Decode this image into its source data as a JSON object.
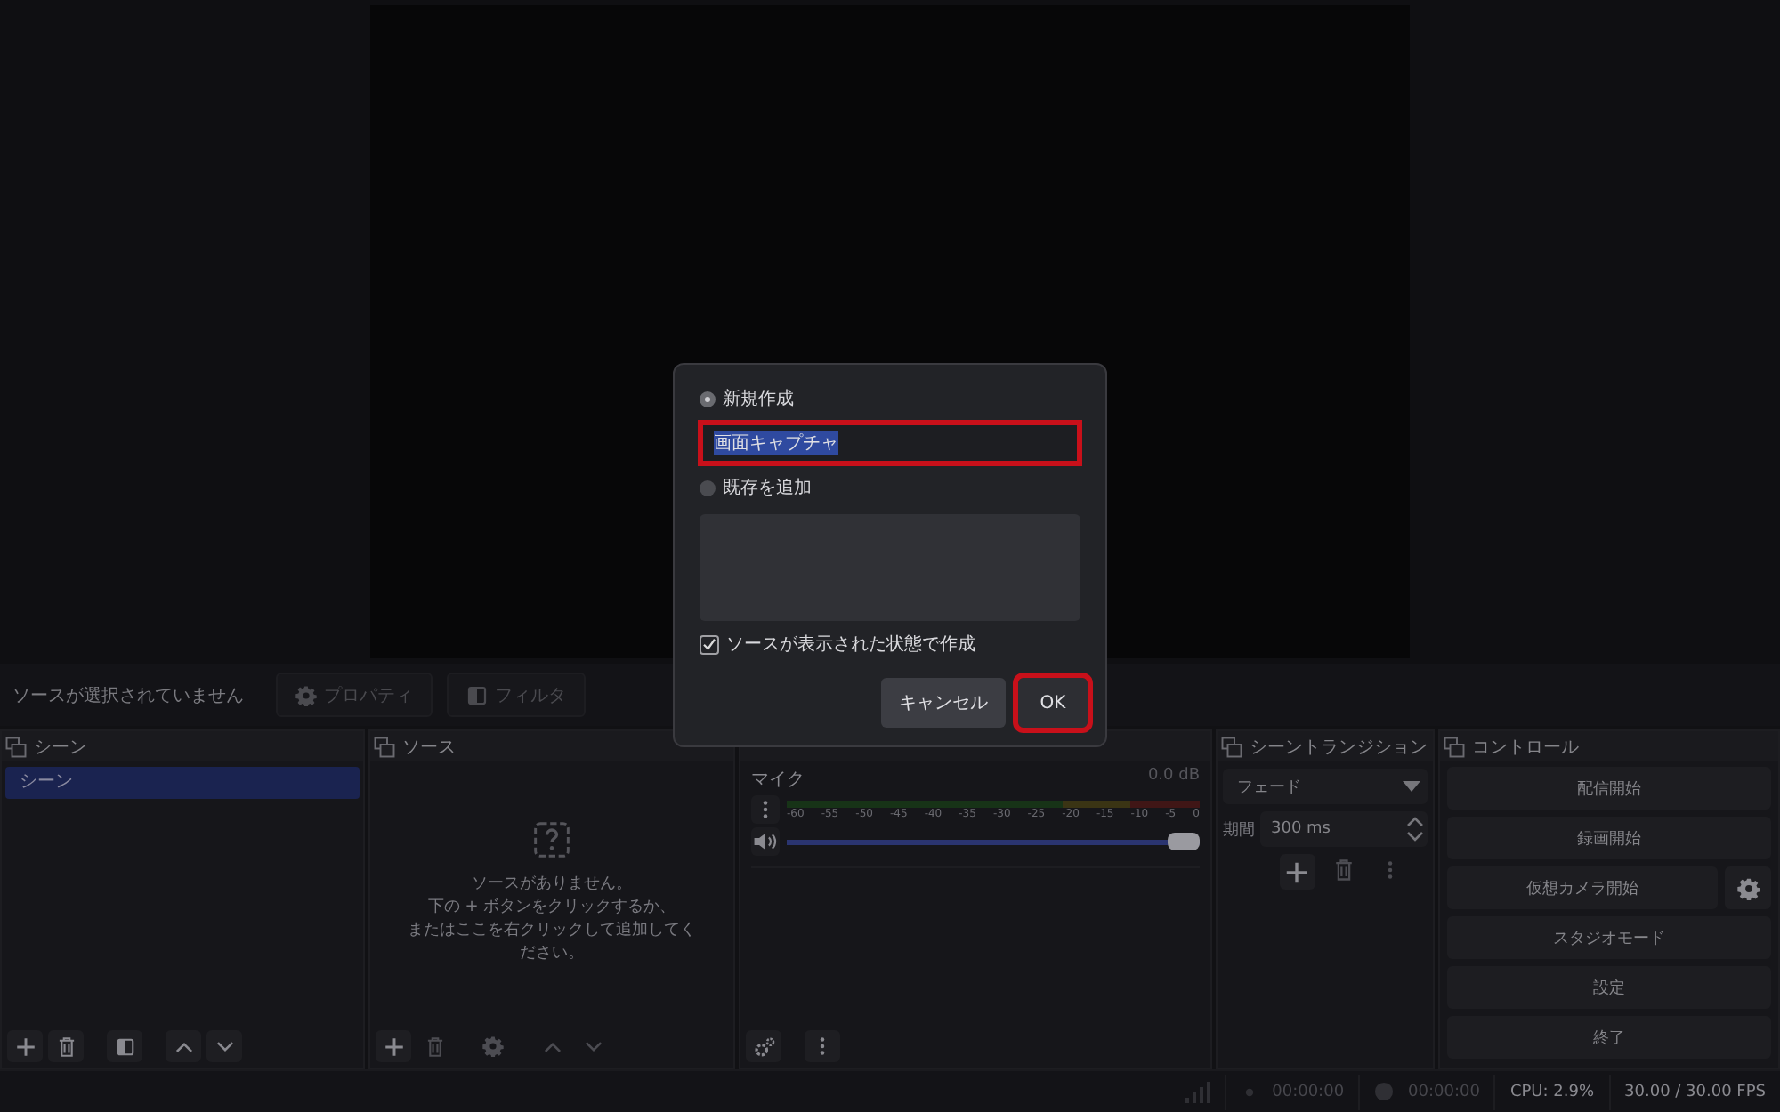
{
  "context_bar": {
    "status": "ソースが選択されていません",
    "buttons": [
      {
        "kind": "properties",
        "label": "プロパティ",
        "disabled": true
      },
      {
        "kind": "filters",
        "label": "フィルタ",
        "disabled": true
      }
    ]
  },
  "scenes": {
    "title": "シーン",
    "items": [
      {
        "label": "シーン",
        "selected": true
      }
    ]
  },
  "sources": {
    "title": "ソース",
    "empty_message": [
      "ソースがありません。",
      "下の + ボタンをクリックするか、",
      "またはここを右クリックして追加してください。"
    ]
  },
  "mixer": {
    "channels": [
      {
        "name": "マイク",
        "reading": "0.0 dB",
        "level": 1.0,
        "ticks": [
          "-60",
          "-55",
          "-50",
          "-45",
          "-40",
          "-35",
          "-30",
          "-25",
          "-20",
          "-15",
          "-10",
          "-5",
          "0"
        ]
      }
    ]
  },
  "transitions": {
    "title": "シーントランジション",
    "transition": "フェード",
    "duration_label": "期間",
    "duration": "300 ms"
  },
  "controls": {
    "title": "コントロール",
    "buttons": [
      {
        "label": "配信開始",
        "kind": "plain"
      },
      {
        "label": "録画開始",
        "kind": "plain"
      },
      {
        "label": "仮想カメラ開始",
        "kind": "with-settings"
      },
      {
        "label": "スタジオモード",
        "kind": "plain"
      },
      {
        "label": "設定",
        "kind": "plain"
      },
      {
        "label": "終了",
        "kind": "plain"
      }
    ]
  },
  "status_bar": {
    "stream_time": "00:00:00",
    "record_time": "00:00:00",
    "cpu": "CPU: 2.9%",
    "fps": "30.00 / 30.00 FPS"
  },
  "dialog": {
    "options": [
      {
        "label": "新規作成",
        "selected": true
      },
      {
        "label": "既存を追加",
        "selected": false
      }
    ],
    "name_field": {
      "value": "画面キャプチャ",
      "text_selected": true,
      "highlighted": true
    },
    "visible_checkbox": {
      "label": "ソースが表示された状態で作成",
      "checked": true
    },
    "buttons": [
      {
        "label": "キャンセル",
        "highlighted": false
      },
      {
        "label": "OK",
        "highlighted": true
      }
    ]
  }
}
